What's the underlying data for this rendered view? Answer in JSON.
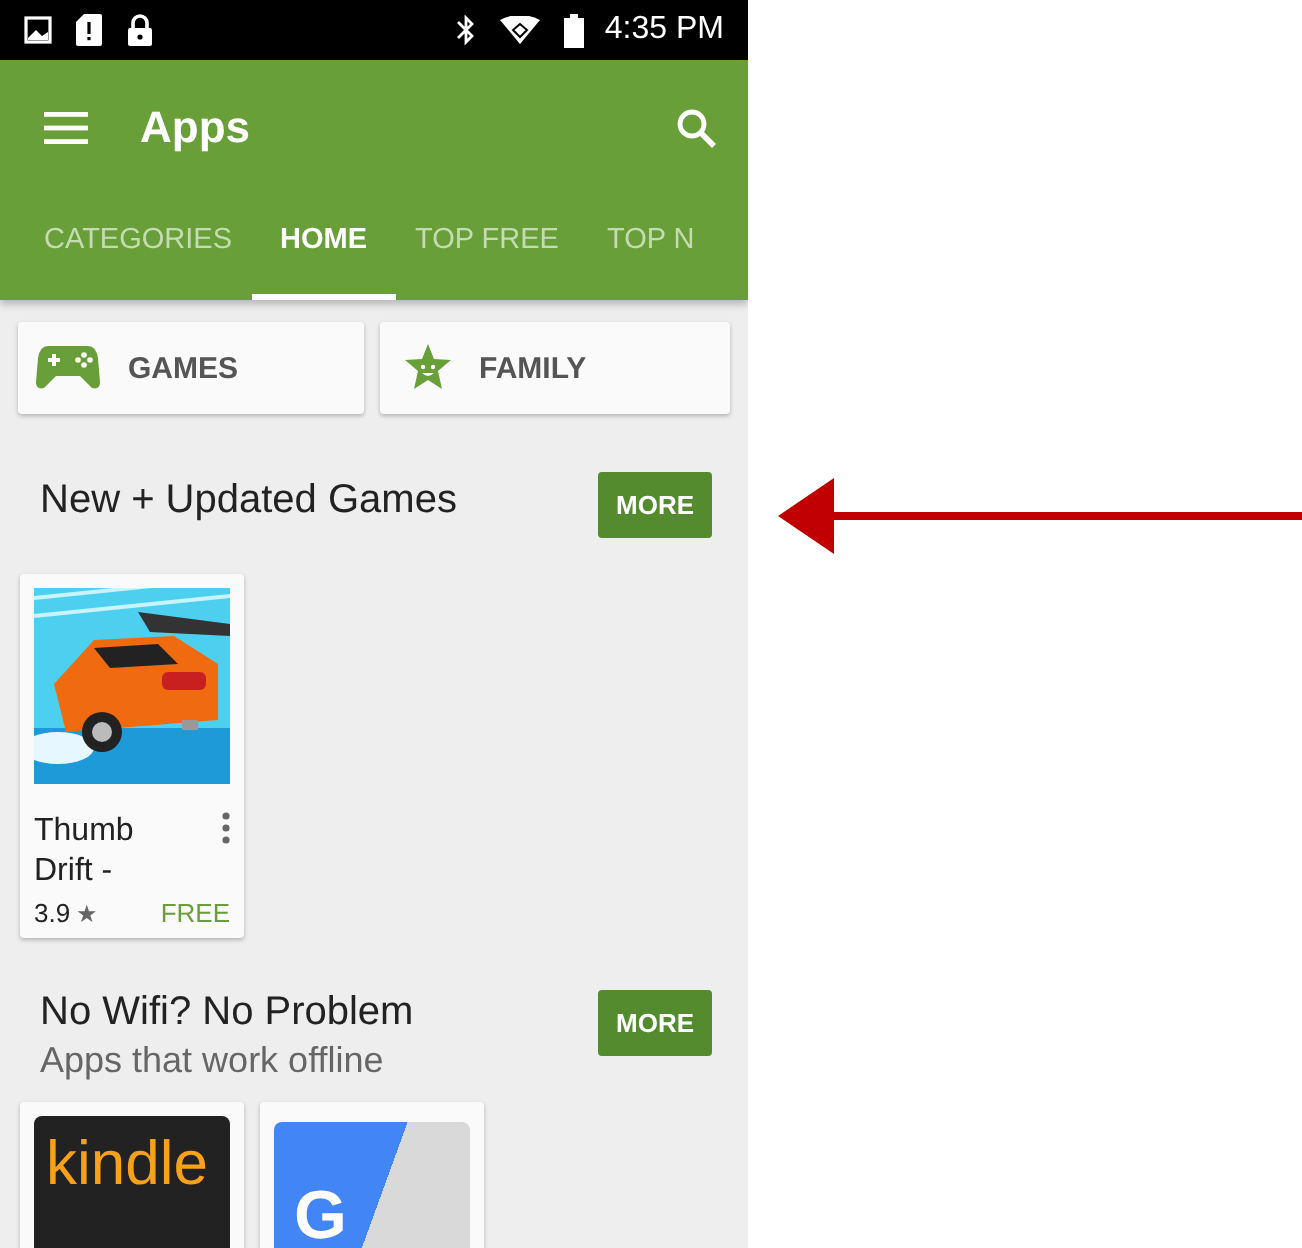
{
  "status_bar": {
    "time": "4:35 PM"
  },
  "toolbar": {
    "title": "Apps"
  },
  "tabs": [
    {
      "label": "CATEGORIES",
      "selected": false
    },
    {
      "label": "HOME",
      "selected": true
    },
    {
      "label": "TOP FREE",
      "selected": false
    },
    {
      "label": "TOP N",
      "selected": false
    }
  ],
  "categories": [
    {
      "label": "GAMES",
      "kind": "games"
    },
    {
      "label": "FAMILY",
      "kind": "family"
    }
  ],
  "sections": [
    {
      "title": "New + Updated Games",
      "button": "MORE",
      "apps": [
        {
          "kind": "car",
          "name": "Thumb Drift -",
          "rating": "3.9",
          "star": "★",
          "price": "FREE"
        }
      ]
    },
    {
      "title": "No Wifi? No Problem",
      "subtitle": "Apps that work offline",
      "button": "MORE",
      "apps": [
        {
          "kind": "kindle",
          "logo": "kindle"
        },
        {
          "kind": "translate",
          "logo": "G"
        }
      ]
    }
  ]
}
